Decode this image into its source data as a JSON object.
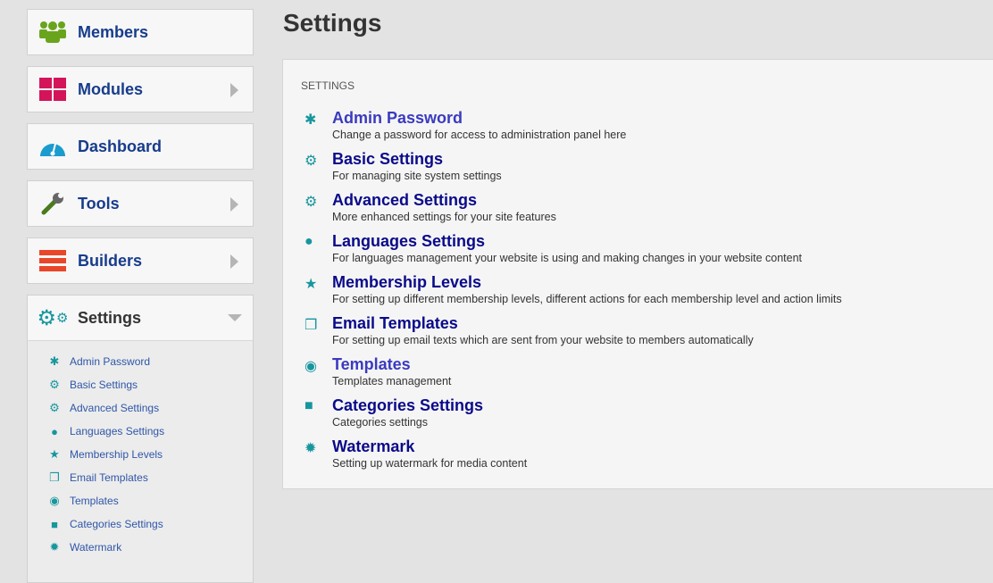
{
  "sidebar": {
    "items": [
      {
        "label": "Members",
        "icon": "members-icon"
      },
      {
        "label": "Modules",
        "icon": "modules-icon"
      },
      {
        "label": "Dashboard",
        "icon": "dashboard-icon"
      },
      {
        "label": "Tools",
        "icon": "wrench-icon"
      },
      {
        "label": "Builders",
        "icon": "bars-icon"
      },
      {
        "label": "Settings",
        "icon": "gears-icon"
      }
    ],
    "submenu": [
      "Admin Password",
      "Basic Settings",
      "Advanced Settings",
      "Languages Settings",
      "Membership Levels",
      "Email Templates",
      "Templates",
      "Categories Settings",
      "Watermark"
    ]
  },
  "page": {
    "title": "Settings",
    "section_caption": "SETTINGS"
  },
  "settings": [
    {
      "title": "Admin Password",
      "desc": "Change a password for access to administration panel here"
    },
    {
      "title": "Basic Settings",
      "desc": "For managing site system settings"
    },
    {
      "title": "Advanced Settings",
      "desc": "More enhanced settings for your site features"
    },
    {
      "title": "Languages Settings",
      "desc": "For languages management your website is using and making changes in your website content"
    },
    {
      "title": "Membership Levels",
      "desc": "For setting up different membership levels, different actions for each membership level and action limits"
    },
    {
      "title": "Email Templates",
      "desc": "For setting up email texts which are sent from your website to members automatically"
    },
    {
      "title": "Templates",
      "desc": "Templates management"
    },
    {
      "title": "Categories Settings",
      "desc": "Categories settings"
    },
    {
      "title": "Watermark",
      "desc": "Setting up watermark for media content"
    }
  ]
}
